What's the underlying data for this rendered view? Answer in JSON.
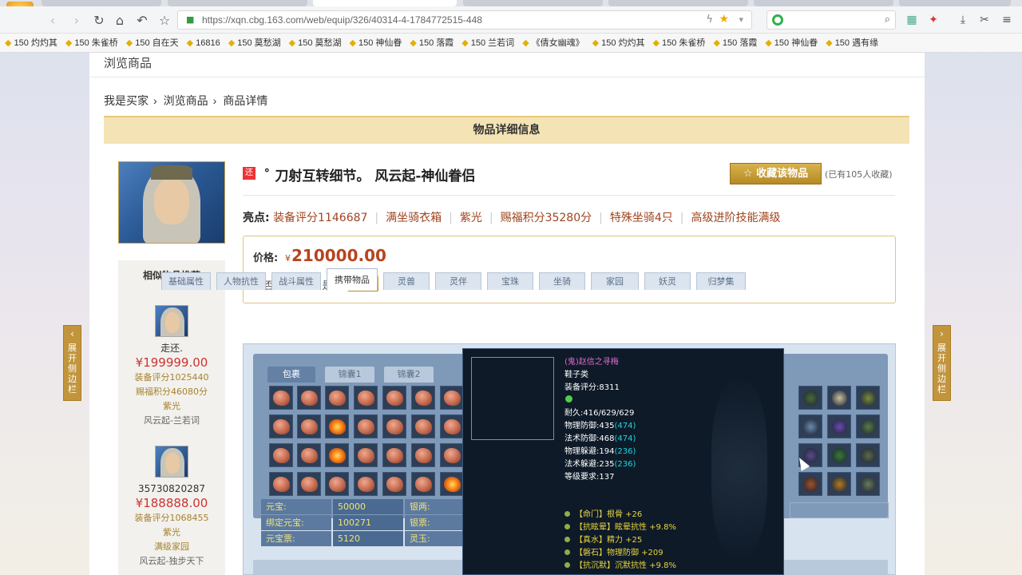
{
  "browser": {
    "url": "https://xqn.cbg.163.com/web/equip/326/40314-4-1784772515-448",
    "bookmarks": [
      "150 灼灼其",
      "150 朱雀桥",
      "150 自在天",
      "16816",
      "150 莫愁湖",
      "150 莫愁湖",
      "150 神仙眷",
      "150 落霞",
      "150 兰若词",
      "《倩女幽魂》",
      "150 灼灼其",
      "150 朱雀桥",
      "150 落霞",
      "150 神仙眷",
      "150 遇有缘"
    ]
  },
  "page": {
    "section_title": "浏览商品",
    "breadcrumb": [
      "我是买家",
      "浏览商品",
      "商品详情"
    ],
    "info_bar": "物品详细信息",
    "item_badge": "还",
    "item_title": "˚ 刀射互转细节。  风云起-神仙眷侣",
    "fav_button": "收藏该物品",
    "fav_note": "(已有105人收藏)",
    "highlights_label": "亮点:",
    "highlights": [
      "装备评分1146687",
      "满坐骑衣箱",
      "紫光",
      "赐福积分35280分",
      "特殊坐骑4只",
      "高级进阶技能满级"
    ],
    "price_label": "价格:",
    "price_symbol": "¥",
    "price_value": "210000.00",
    "bargain_label": "是否接受还价:  是",
    "bargain_button": "还价"
  },
  "sidebar": {
    "heading": "相似物品推荐",
    "items": [
      {
        "name": "走还.",
        "price": "¥199999.00",
        "score": "装备评分1025440",
        "points": "赐福积分46080分",
        "light": "紫光",
        "server": "风云起-兰若词"
      },
      {
        "name": "35730820287",
        "price": "¥188888.00",
        "score": "装备评分1068455",
        "light": "紫光",
        "extra": "满级家园",
        "server": "风云起-独步天下"
      }
    ]
  },
  "tabs": [
    "基础属性",
    "人物抗性",
    "战斗属性",
    "携带物品",
    "灵兽",
    "灵伴",
    "宝珠",
    "坐骑",
    "家园",
    "妖灵",
    "归梦集"
  ],
  "inventory": {
    "tabs": [
      "包裹",
      "锦囊1",
      "锦囊2"
    ],
    "currency": {
      "yuanbao_label": "元宝:",
      "yuanbao": "50000",
      "yinliang_label": "银两:",
      "bind_label": "绑定元宝:",
      "bind": "100271",
      "yinpiao_label": "银票:",
      "piao_label": "元宝票:",
      "piao": "5120",
      "lingyu_label": "灵玉:"
    }
  },
  "tooltip": {
    "name": "(鬼)赵信之寻梅",
    "type": "鞋子类",
    "score": "装备评分:8311",
    "stats": [
      {
        "t": "耐久:416/629/629",
        "x": ""
      },
      {
        "t": "物理防御:435",
        "x": "(474)"
      },
      {
        "t": "法术防御:468",
        "x": "(474)"
      },
      {
        "t": "物理躲避:194",
        "x": "(236)"
      },
      {
        "t": "法术躲避:235",
        "x": "(236)"
      },
      {
        "t": "等级要求:137",
        "x": ""
      }
    ],
    "gems": [
      "【命门】根骨 +26",
      "【抗眩晕】眩晕抗性 +9.8%",
      "【真水】精力 +25",
      "【磐石】物理防御 +209",
      "【抗沉默】沉默抗性 +9.8%"
    ]
  },
  "side_buttons": {
    "left": "展开侧边栏",
    "right": "展开侧边栏"
  }
}
